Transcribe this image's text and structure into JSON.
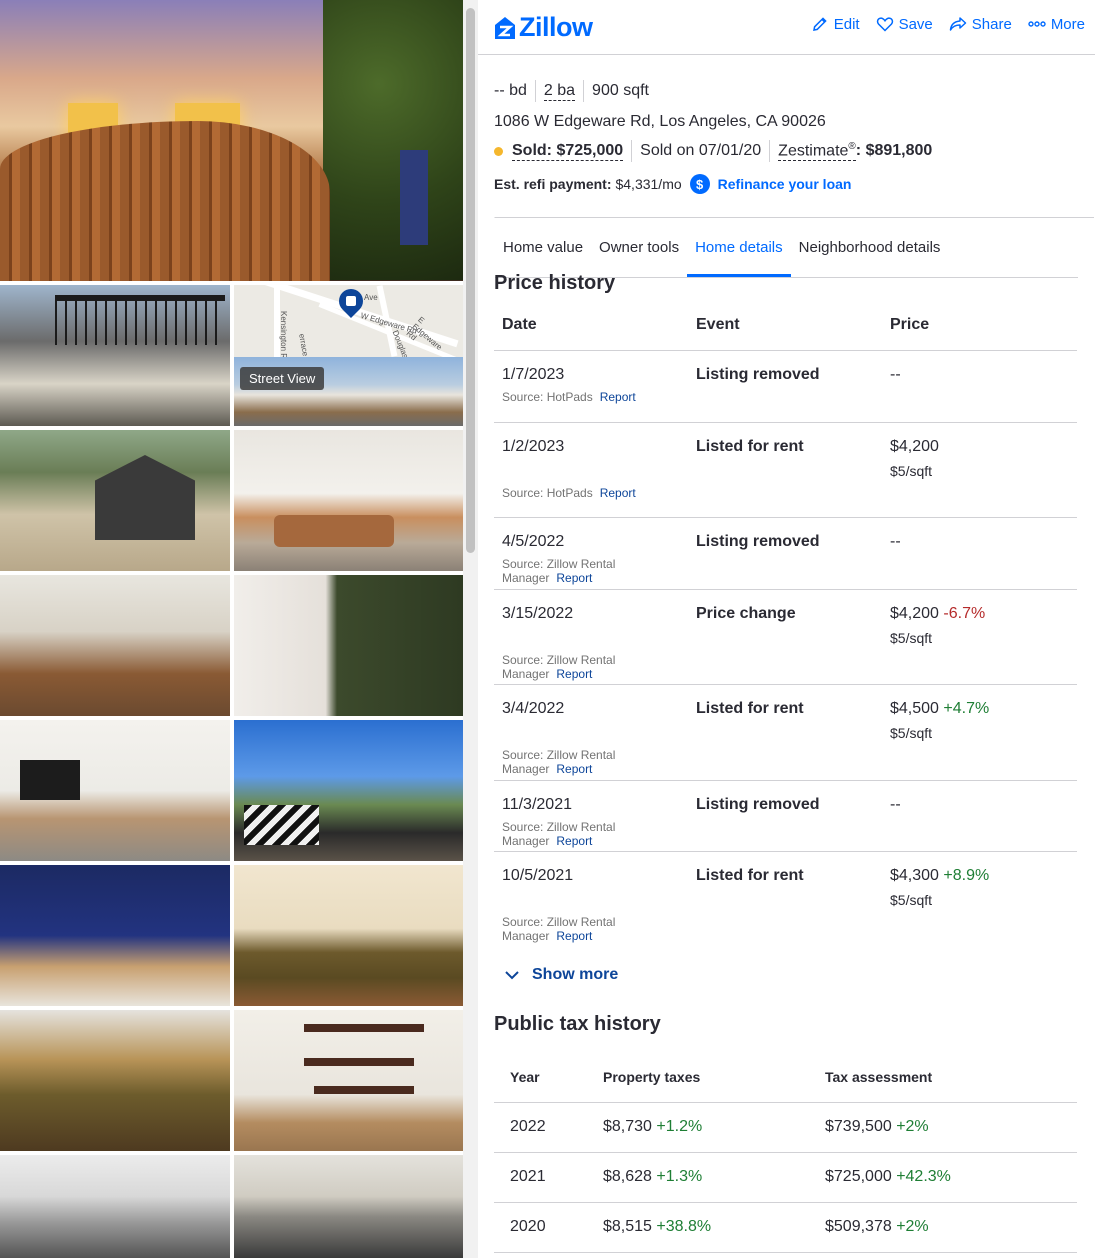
{
  "header": {
    "logo_text": "Zillow",
    "actions": [
      {
        "label": "Edit",
        "icon": "pencil-icon"
      },
      {
        "label": "Save",
        "icon": "heart-icon"
      },
      {
        "label": "Share",
        "icon": "share-icon"
      },
      {
        "label": "More",
        "icon": "more-dots-icon"
      }
    ]
  },
  "gallery": {
    "street_view_label": "Street View",
    "map_labels": [
      "W Edgeware Rd",
      "E Edgeware Rd",
      "Douglas St",
      "Kensington Rd",
      "Ave",
      "errace"
    ]
  },
  "summary": {
    "beds": "-- bd",
    "baths": "2 ba",
    "sqft": "900 sqft",
    "address": "1086 W Edgeware Rd, Los Angeles, CA 90026",
    "sold_label": "Sold: $725,000",
    "sold_on": "Sold on 07/01/20",
    "zestimate_label": "Zestimate",
    "zestimate_sup": "®",
    "zestimate_value": ": $891,800",
    "refi_label": "Est. refi payment:",
    "refi_value": "$4,331/mo",
    "refi_icon": "$",
    "refi_link": "Refinance your loan"
  },
  "tabs": [
    "Home value",
    "Owner tools",
    "Home details",
    "Neighborhood details"
  ],
  "price_history": {
    "title": "Price history",
    "columns": [
      "Date",
      "Event",
      "Price"
    ],
    "rows": [
      {
        "date": "1/7/2023",
        "event": "Listing removed",
        "price": "--",
        "change": "",
        "sqft": "",
        "source": "Source: HotPads",
        "report": "Report"
      },
      {
        "date": "1/2/2023",
        "event": "Listed for rent",
        "price": "$4,200",
        "change": "",
        "sqft": "$5/sqft",
        "source": "Source: HotPads",
        "report": "Report"
      },
      {
        "date": "4/5/2022",
        "event": "Listing removed",
        "price": "--",
        "change": "",
        "sqft": "",
        "source": "Source: Zillow Rental Manager",
        "report": "Report"
      },
      {
        "date": "3/15/2022",
        "event": "Price change",
        "price": "$4,200",
        "change": "-6.7%",
        "sqft": "$5/sqft",
        "source": "Source: Zillow Rental Manager",
        "report": "Report"
      },
      {
        "date": "3/4/2022",
        "event": "Listed for rent",
        "price": "$4,500",
        "change": "+4.7%",
        "sqft": "$5/sqft",
        "source": "Source: Zillow Rental Manager",
        "report": "Report"
      },
      {
        "date": "11/3/2021",
        "event": "Listing removed",
        "price": "--",
        "change": "",
        "sqft": "",
        "source": "Source: Zillow Rental Manager",
        "report": "Report"
      },
      {
        "date": "10/5/2021",
        "event": "Listed for rent",
        "price": "$4,300",
        "change": "+8.9%",
        "sqft": "$5/sqft",
        "source": "Source: Zillow Rental Manager",
        "report": "Report"
      }
    ],
    "show_more": "Show more"
  },
  "tax_history": {
    "title": "Public tax history",
    "columns": [
      "Year",
      "Property taxes",
      "Tax assessment"
    ],
    "rows": [
      {
        "year": "2022",
        "taxes": "$8,730",
        "taxes_change": "+1.2%",
        "assessment": "$739,500",
        "assessment_change": "+2%"
      },
      {
        "year": "2021",
        "taxes": "$8,628",
        "taxes_change": "+1.3%",
        "assessment": "$725,000",
        "assessment_change": "+42.3%"
      },
      {
        "year": "2020",
        "taxes": "$8,515",
        "taxes_change": "+38.8%",
        "assessment": "$509,378",
        "assessment_change": "+2%"
      }
    ]
  },
  "colors": {
    "brand_blue": "#006aff",
    "link_dark_blue": "#0d4599",
    "sold_dot": "#f5b72d",
    "negative": "#b52b2b",
    "positive": "#1e7e34"
  }
}
